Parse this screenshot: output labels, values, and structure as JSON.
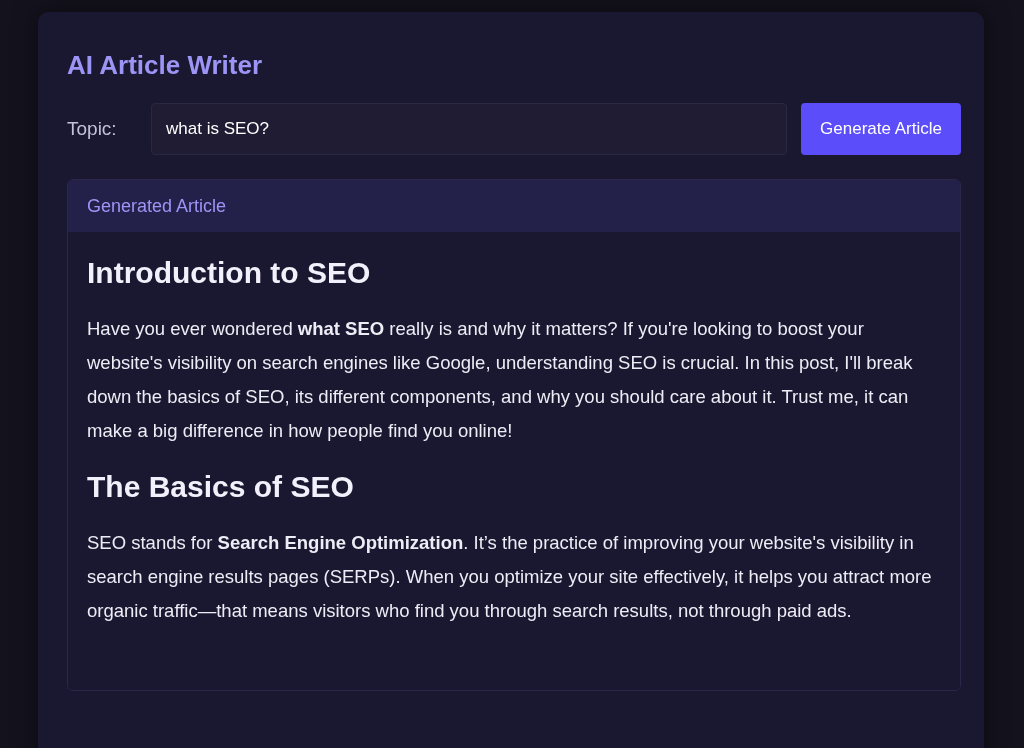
{
  "title": "AI Article Writer",
  "topic": {
    "label": "Topic:",
    "value": "what is SEO?"
  },
  "generate_button": "Generate Article",
  "article_panel": {
    "title": "Generated Article",
    "blocks": [
      {
        "kind": "heading",
        "text": "Introduction to SEO"
      },
      {
        "kind": "paragraph",
        "text": "Have you ever wondered **what SEO** really is and why it matters? If you're looking to boost your website's visibility on search engines like Google, understanding SEO is crucial. In this post, I'll break down the basics of SEO, its different components, and why you should care about it. Trust me, it can make a big difference in how people find you online!"
      },
      {
        "kind": "heading",
        "text": "The Basics of SEO"
      },
      {
        "kind": "paragraph",
        "text": "SEO stands for **Search Engine Optimization**. It’s the practice of improving your website's visibility in search engine results pages (SERPs). When you optimize your site effectively, it helps you attract more organic traffic—that means visitors who find you through search results, not through paid ads."
      }
    ]
  }
}
